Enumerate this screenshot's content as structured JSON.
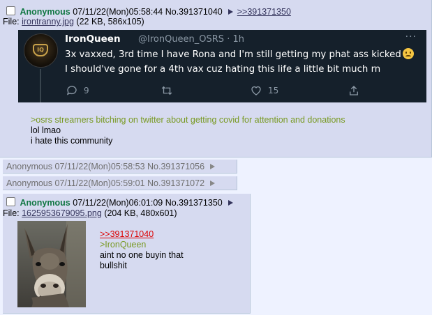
{
  "posts": [
    {
      "name": "Anonymous",
      "datetime": "07/11/22(Mon)05:58:44",
      "number": "No.391371040",
      "backlink": ">>391371350",
      "file_label": "File:",
      "file_name": "irontranny.jpg",
      "file_meta": "(22 KB, 586x105)",
      "tweet": {
        "display_name": "IronQueen",
        "handle": "@IronQueen_OSRS · 1h",
        "line1": "3x vaxxed, 3rd time I have Rona and I'm still getting my phat ass kicked",
        "line2": "I should've gone for a 4th vax cuz hating this life a little bit much rn",
        "replies": "9",
        "likes": "15",
        "avatar_text": "IQ"
      },
      "quote": ">osrs streamers bitching on twitter about getting covid for attention and donations",
      "lines": [
        "lol lmao",
        "i hate this community"
      ]
    },
    {
      "name": "Anonymous",
      "datetime": "07/11/22(Mon)05:58:53",
      "number": "No.391371056"
    },
    {
      "name": "Anonymous",
      "datetime": "07/11/22(Mon)05:59:01",
      "number": "No.391371072"
    },
    {
      "name": "Anonymous",
      "datetime": "07/11/22(Mon)06:01:09",
      "number": "No.391371350",
      "file_label": "File:",
      "file_name": "1625953679095.png",
      "file_meta": "(204 KB, 480x601)",
      "reply_link": ">>391371040",
      "quote": ">IronQueen",
      "lines": [
        "aint no one buyin that",
        "bullshit"
      ]
    }
  ]
}
